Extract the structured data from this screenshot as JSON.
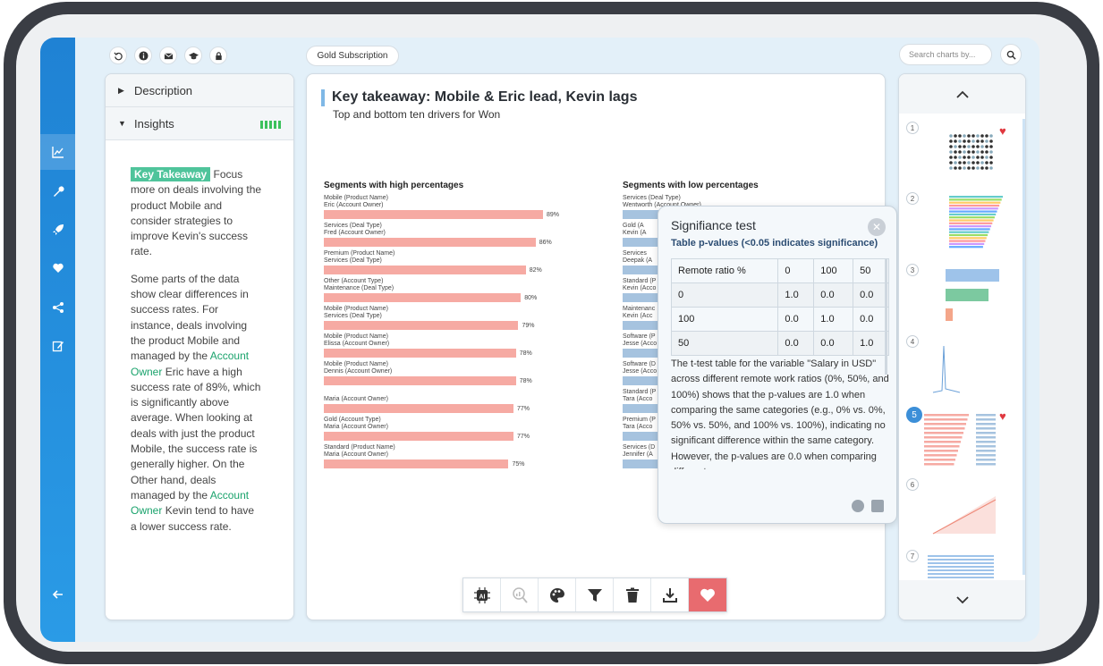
{
  "top_toolbar": {
    "subscription_label": "Gold Subscription",
    "search_placeholder": "Search charts by..."
  },
  "left_panel": {
    "description_label": "Description",
    "insights_label": "Insights",
    "key_takeaway_tag": "Key Takeaway",
    "paragraph1_after_tag": "Focus more on deals involving the product Mobile and consider strategies to improve Kevin's success rate.",
    "p2_part1": "Some parts of the data show clear differences in success rates. For instance, deals involving the product Mobile and managed by the",
    "p2_hl1": "Account Owner",
    "p2_part2": "Eric have a high success rate of 89%, which is significantly above average. When looking at deals with just the product Mobile, the success rate is generally higher. On the Other hand, deals managed by the",
    "p2_hl2": "Account Owner",
    "p2_part3": "Kevin tend to have a lower success rate."
  },
  "main": {
    "title": "Key takeaway: Mobile & Eric lead, Kevin lags",
    "subtitle": "Top and bottom ten drivers for Won"
  },
  "chart_data": [
    {
      "type": "bar",
      "title": "Segments with high percentages",
      "categories": [
        [
          "Mobile (Product Name)",
          "Eric (Account Owner)"
        ],
        [
          "Services (Deal Type)",
          "Fred (Account Owner)"
        ],
        [
          "Premium (Product Name)",
          "Services (Deal Type)"
        ],
        [
          "Other (Account Type)",
          "Maintenance (Deal Type)"
        ],
        [
          "Mobile (Product Name)",
          "Services (Deal Type)"
        ],
        [
          "Mobile (Product Name)",
          "Elissa (Account Owner)"
        ],
        [
          "Mobile (Product Name)",
          "Dennis (Account Owner)"
        ],
        [
          "Maria (Account Owner)"
        ],
        [
          "Gold (Account Type)",
          "Maria (Account Owner)"
        ],
        [
          "Standard (Product Name)",
          "Maria (Account Owner)"
        ]
      ],
      "values": [
        89,
        86,
        82,
        80,
        79,
        78,
        78,
        77,
        77,
        75
      ],
      "value_labels": [
        "89%",
        "86%",
        "82%",
        "80%",
        "79%",
        "78%",
        "78%",
        "77%",
        "77%",
        "75%"
      ]
    },
    {
      "type": "bar",
      "title": "Segments with low percentages",
      "categories": [
        [
          "Services (Deal Type)",
          "Wentworth (Account Owner)"
        ],
        [
          "Gold (A",
          "Kevin (A"
        ],
        [
          "Services",
          "Deepak (A"
        ],
        [
          "Standard (P",
          "Kevin (Acco"
        ],
        [
          "Maintenanc",
          "Kevin (Acc"
        ],
        [
          "Software (P",
          "Jesse (Acco"
        ],
        [
          "Software (D",
          "Jesse (Acco"
        ],
        [
          "Standard (P",
          "Tara (Acco"
        ],
        [
          "Premium (P",
          "Tara (Acco"
        ],
        [
          "Services (D",
          "Jennifer (A"
        ]
      ]
    }
  ],
  "popup": {
    "title": "Signifiance test",
    "subtitle": "Table p-values (<0.05 indicates significance)",
    "header": [
      "Remote ratio %",
      "0",
      "100",
      "50"
    ],
    "rows": [
      [
        "0",
        "1.0",
        "0.0",
        "0.0"
      ],
      [
        "100",
        "0.0",
        "1.0",
        "0.0"
      ],
      [
        "50",
        "0.0",
        "0.0",
        "1.0"
      ]
    ],
    "text": "The t-test table for the variable \"Salary in USD\" across different remote work ratios (0%, 50%, and 100%) shows that the p-values are 1.0 when comparing the same categories (e.g., 0% vs. 0%, 50% vs. 50%, and 100% vs. 100%), indicating no significant difference within the same category. However, the p-values are 0.0 when comparing different"
  },
  "thumbnails": [
    "1",
    "2",
    "3",
    "4",
    "5",
    "6",
    "7"
  ],
  "colors": {
    "rail": "#1f82d4",
    "high_bar": "#f6aaa3",
    "low_bar": "#a6c3df",
    "takeaway_tag": "#4fc49b",
    "favorite": "#e86b6f"
  }
}
